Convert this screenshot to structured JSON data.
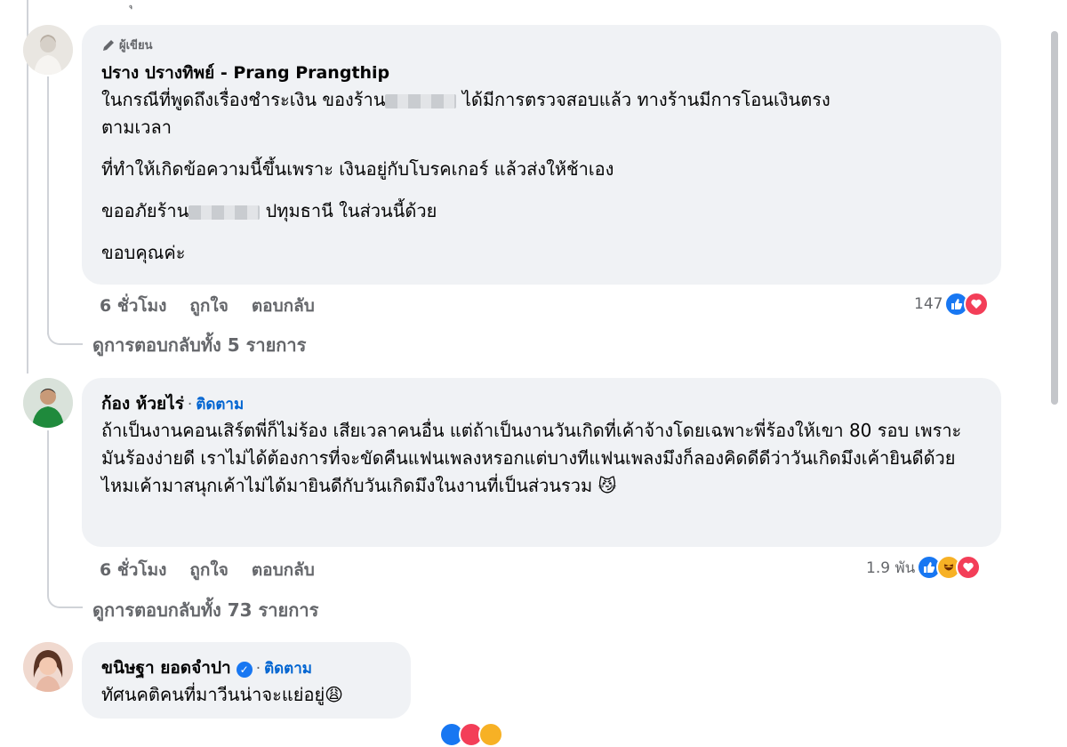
{
  "top_fragment": "ุ",
  "comments": [
    {
      "badge": "ผู้เขียน",
      "author": "ปราง ปรางทิพย์ - Prang Prangthip",
      "line1_prefix": "ในกรณีที่พูดถึงเรื่องชำระเงิน ของร้าน",
      "line1_suffix": "ได้มีการตรวจสอบแล้ว ทางร้านมีการโอนเงินตรง",
      "line2": "ตามเวลา",
      "para2": "ที่ทำให้เกิดข้อความนี้ขึ้นเพราะ เงินอยู่กับโบรคเกอร์ แล้วส่งให้ช้าเอง",
      "para3_prefix": "ขออภัยร้าน",
      "para3_suffix": "ปทุมธานี ในส่วนนี้ด้วย",
      "para4": "ขอบคุณค่ะ",
      "time": "6 ชั่วโมง",
      "like": "ถูกใจ",
      "reply": "ตอบกลับ",
      "reaction_count": "147",
      "view_replies": "ดูการตอบกลับทั้ง 5 รายการ"
    },
    {
      "author": "ก้อง ห้วยไร่",
      "follow": "ติดตาม",
      "text": "ถ้าเป็นงานคอนเสิร์ตพี่ก็ไม่ร้อง เสียเวลาคนอื่น แต่ถ้าเป็นงานวันเกิดที่เค้าจ้างโดยเฉพาะพี่ร้องให้เขา 80 รอบ เพราะมันร้องง่ายดี เราไม่ได้ต้องการที่จะขัดคืนแฟนเพลงหรอกแต่บางทีแฟนเพลงมึงก็ลองคิดดีดีว่าวันเกิดมึงเค้ายินดีด้วยไหมเค้ามาสนุกเค้าไม่ได้มายินดีกับวันเกิดมึงในงานที่เป็นส่วนรวม",
      "emoji": "😼",
      "time": "6 ชั่วโมง",
      "like": "ถูกใจ",
      "reply": "ตอบกลับ",
      "reaction_count": "1.9 พัน",
      "view_replies": "ดูการตอบกลับทั้ง 73 รายการ"
    },
    {
      "author": "ขนิษฐา ยอดจำปา",
      "follow": "ติดตาม",
      "text": "ทัศนคติคนที่มาวีนน่าจะแย่อยู่",
      "emoji": "😩"
    }
  ],
  "icons": {
    "pencil": "pencil-icon",
    "like": "like-icon",
    "love": "love-icon",
    "haha": "haha-icon",
    "verified": "verified-badge-icon"
  },
  "colors": {
    "bubble": "#f0f2f5",
    "link": "#0064d1",
    "secondary": "#65676b",
    "like": "#1877f2",
    "love": "#f33e58"
  }
}
